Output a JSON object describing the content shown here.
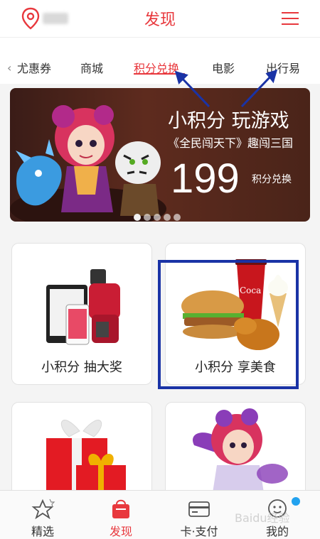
{
  "header": {
    "title": "发现",
    "location_icon": "location-pin-icon",
    "menu_icon": "menu-icon"
  },
  "tabs": [
    {
      "label": "尤惠券",
      "active": false
    },
    {
      "label": "商城",
      "active": false
    },
    {
      "label": "积分兑换",
      "active": true
    },
    {
      "label": "电影",
      "active": false
    },
    {
      "label": "出行易",
      "active": false
    }
  ],
  "banner": {
    "headline": "小积分 玩游戏",
    "subtitle": "《全民闯天下》趣闯三国",
    "points": "199",
    "points_unit": "积分兑换",
    "pager_count": 5,
    "pager_active": 0
  },
  "cards": [
    {
      "label": "小积分 抽大奖",
      "art": "electronics-prize-icon"
    },
    {
      "label": "小积分 享美食",
      "art": "burger-meal-icon",
      "highlighted": true
    }
  ],
  "bottom_nav": [
    {
      "label": "精选",
      "icon": "star-icon",
      "active": false
    },
    {
      "label": "发现",
      "icon": "shopping-bag-icon",
      "active": true
    },
    {
      "label": "卡·支付",
      "icon": "card-icon",
      "active": false
    },
    {
      "label": "我的",
      "icon": "profile-icon",
      "active": false
    }
  ],
  "watermark": "Baidu经验",
  "colors": {
    "accent": "#e8383d",
    "annotation_blue": "#1a33a6",
    "badge": "#22a2ef"
  }
}
